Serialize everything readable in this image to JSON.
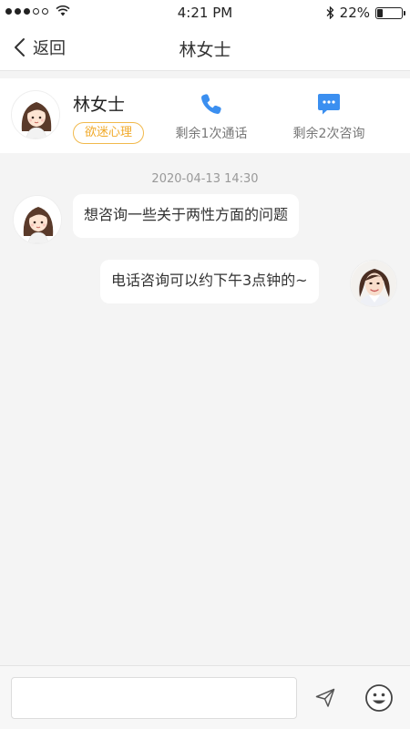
{
  "status_bar": {
    "time": "4:21 PM",
    "battery_text": "22%",
    "battery_level": 0.22,
    "signal_bars_filled": 3,
    "signal_bars_total": 5
  },
  "nav": {
    "back_label": "返回",
    "title": "林女士"
  },
  "profile": {
    "name": "林女士",
    "tag": "欲迷心理",
    "call_label": "剩余1次通话",
    "consult_label": "剩余2次咨询",
    "call_icon": "phone-icon",
    "consult_icon": "chat-bubble-icon",
    "accent_color": "#3b8ff0",
    "tag_color": "#f1a928"
  },
  "chat": {
    "timestamp": "2020-04-13 14:30",
    "messages": [
      {
        "from": "client",
        "text": "想咨询一些关于两性方面的问题"
      },
      {
        "from": "consultant",
        "text": "电话咨询可以约下午3点钟的~"
      }
    ]
  },
  "composer": {
    "placeholder": "",
    "value": "",
    "send_icon": "send-icon",
    "emoji_icon": "emoji-icon"
  }
}
